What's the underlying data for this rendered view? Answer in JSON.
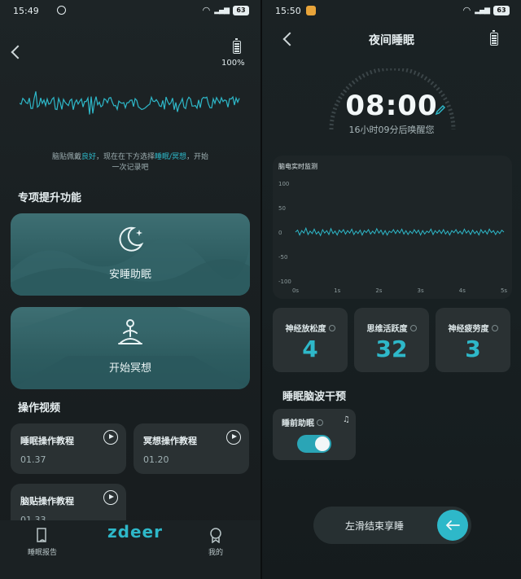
{
  "left": {
    "status": {
      "time": "15:49",
      "battery": "63"
    },
    "battery_percent": "100%",
    "hint_prefix": "脑贴佩戴",
    "hint_good": "良好",
    "hint_middle": "，现在在下方选择",
    "hint_options": "睡眠/冥想",
    "hint_suffix": "，开始",
    "hint_line2": "一次记录吧",
    "features_title": "专项提升功能",
    "feature_sleep": "安睡助眠",
    "feature_meditate": "开始冥想",
    "videos_title": "操作视频",
    "videos": [
      {
        "title": "睡眠操作教程",
        "duration": "01.37"
      },
      {
        "title": "冥想操作教程",
        "duration": "01.20"
      },
      {
        "title": "脑贴操作教程",
        "duration": "01.33"
      }
    ],
    "nav": {
      "report": "睡眠报告",
      "logo": "zdeer",
      "mine": "我的"
    }
  },
  "right": {
    "status": {
      "time": "15:50",
      "battery": "63"
    },
    "title": "夜间睡眠",
    "alarm_time": "08:00",
    "alarm_caption": "16小时09分后唤醒您",
    "monitor_title": "脑电实时监测",
    "metrics": [
      {
        "label": "神经放松度",
        "value": "4"
      },
      {
        "label": "思维活跃度",
        "value": "32"
      },
      {
        "label": "神经疲劳度",
        "value": "3"
      }
    ],
    "intervention_title": "睡眠脑波干预",
    "pre_sleep_label": "睡前助眠",
    "pre_sleep_on": true,
    "slide_label": "左滑结束享睡"
  },
  "chart_data": {
    "type": "line",
    "title": "脑电实时监测",
    "x_ticks": [
      "0s",
      "1s",
      "2s",
      "3s",
      "4s",
      "5s"
    ],
    "y_ticks": [
      "100",
      "50",
      "0",
      "-50",
      "-100"
    ],
    "xlim": [
      0,
      5
    ],
    "ylim": [
      -100,
      100
    ],
    "series": [
      {
        "values": [
          0,
          4,
          -6,
          3,
          -2,
          8,
          -5,
          2,
          -3,
          6,
          -4,
          1,
          -7,
          5,
          -2,
          3,
          -5,
          7,
          -3,
          2,
          -6,
          4,
          -1,
          5,
          -4,
          3,
          -2,
          6,
          -5,
          2,
          -3,
          4,
          -6,
          3,
          -1,
          5,
          -4,
          2,
          -3,
          7,
          -2,
          4,
          -5,
          3,
          -6,
          2,
          -1,
          5,
          -3,
          4,
          -2,
          6,
          -4,
          3,
          -5,
          2,
          -3,
          5,
          -2,
          4,
          -6,
          3,
          -4,
          2,
          -1,
          6,
          -5,
          3,
          -2,
          4,
          -3,
          5,
          -4,
          2,
          -6,
          3,
          -1,
          5,
          -3,
          2,
          -4,
          6,
          -2,
          3,
          -5,
          4,
          -3,
          2,
          -6,
          5,
          -2,
          3,
          -4,
          6,
          -1,
          3,
          -5,
          2,
          -3,
          4,
          0
        ]
      }
    ],
    "grid": false,
    "color": "#2eb8c9"
  }
}
